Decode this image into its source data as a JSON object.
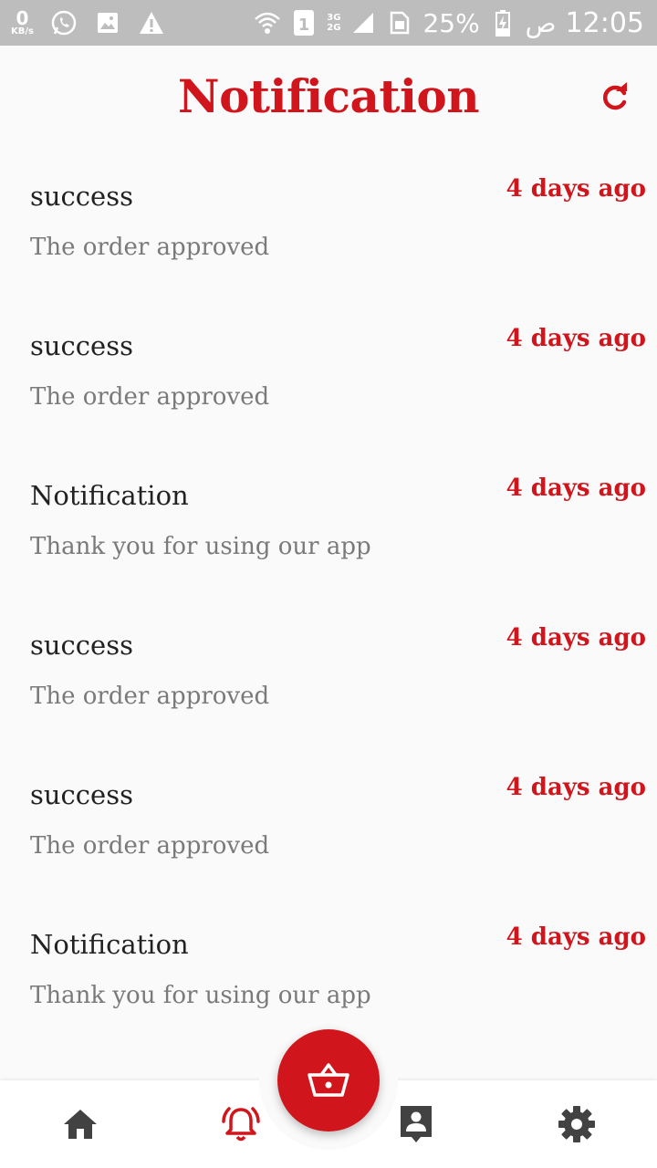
{
  "status_bar": {
    "speed_value": "0",
    "speed_unit": "KB/s",
    "network_top": "3G",
    "network_bottom": "2G",
    "sim_slot": "1",
    "battery": "25%",
    "ampm": "ص",
    "time": "12:05"
  },
  "header": {
    "title": "Notification"
  },
  "notifications": [
    {
      "title": "success",
      "body": "The order approved",
      "time": "4 days ago"
    },
    {
      "title": "success",
      "body": "The order approved",
      "time": "4 days ago"
    },
    {
      "title": "Notification",
      "body": "Thank you for using our app",
      "time": "4 days ago"
    },
    {
      "title": "success",
      "body": "The order approved",
      "time": "4 days ago"
    },
    {
      "title": "success",
      "body": "The order approved",
      "time": "4 days ago"
    },
    {
      "title": "Notification",
      "body": "Thank you for using our app",
      "time": "4 days ago"
    }
  ],
  "colors": {
    "accent": "#d0161c",
    "status_bar": "#bdbdbd",
    "icon_dark": "#424242"
  },
  "bottom_nav": {
    "items": [
      "home-icon",
      "bell-icon",
      "basket-icon",
      "contact-icon",
      "gear-icon"
    ],
    "active": "bell-icon"
  }
}
